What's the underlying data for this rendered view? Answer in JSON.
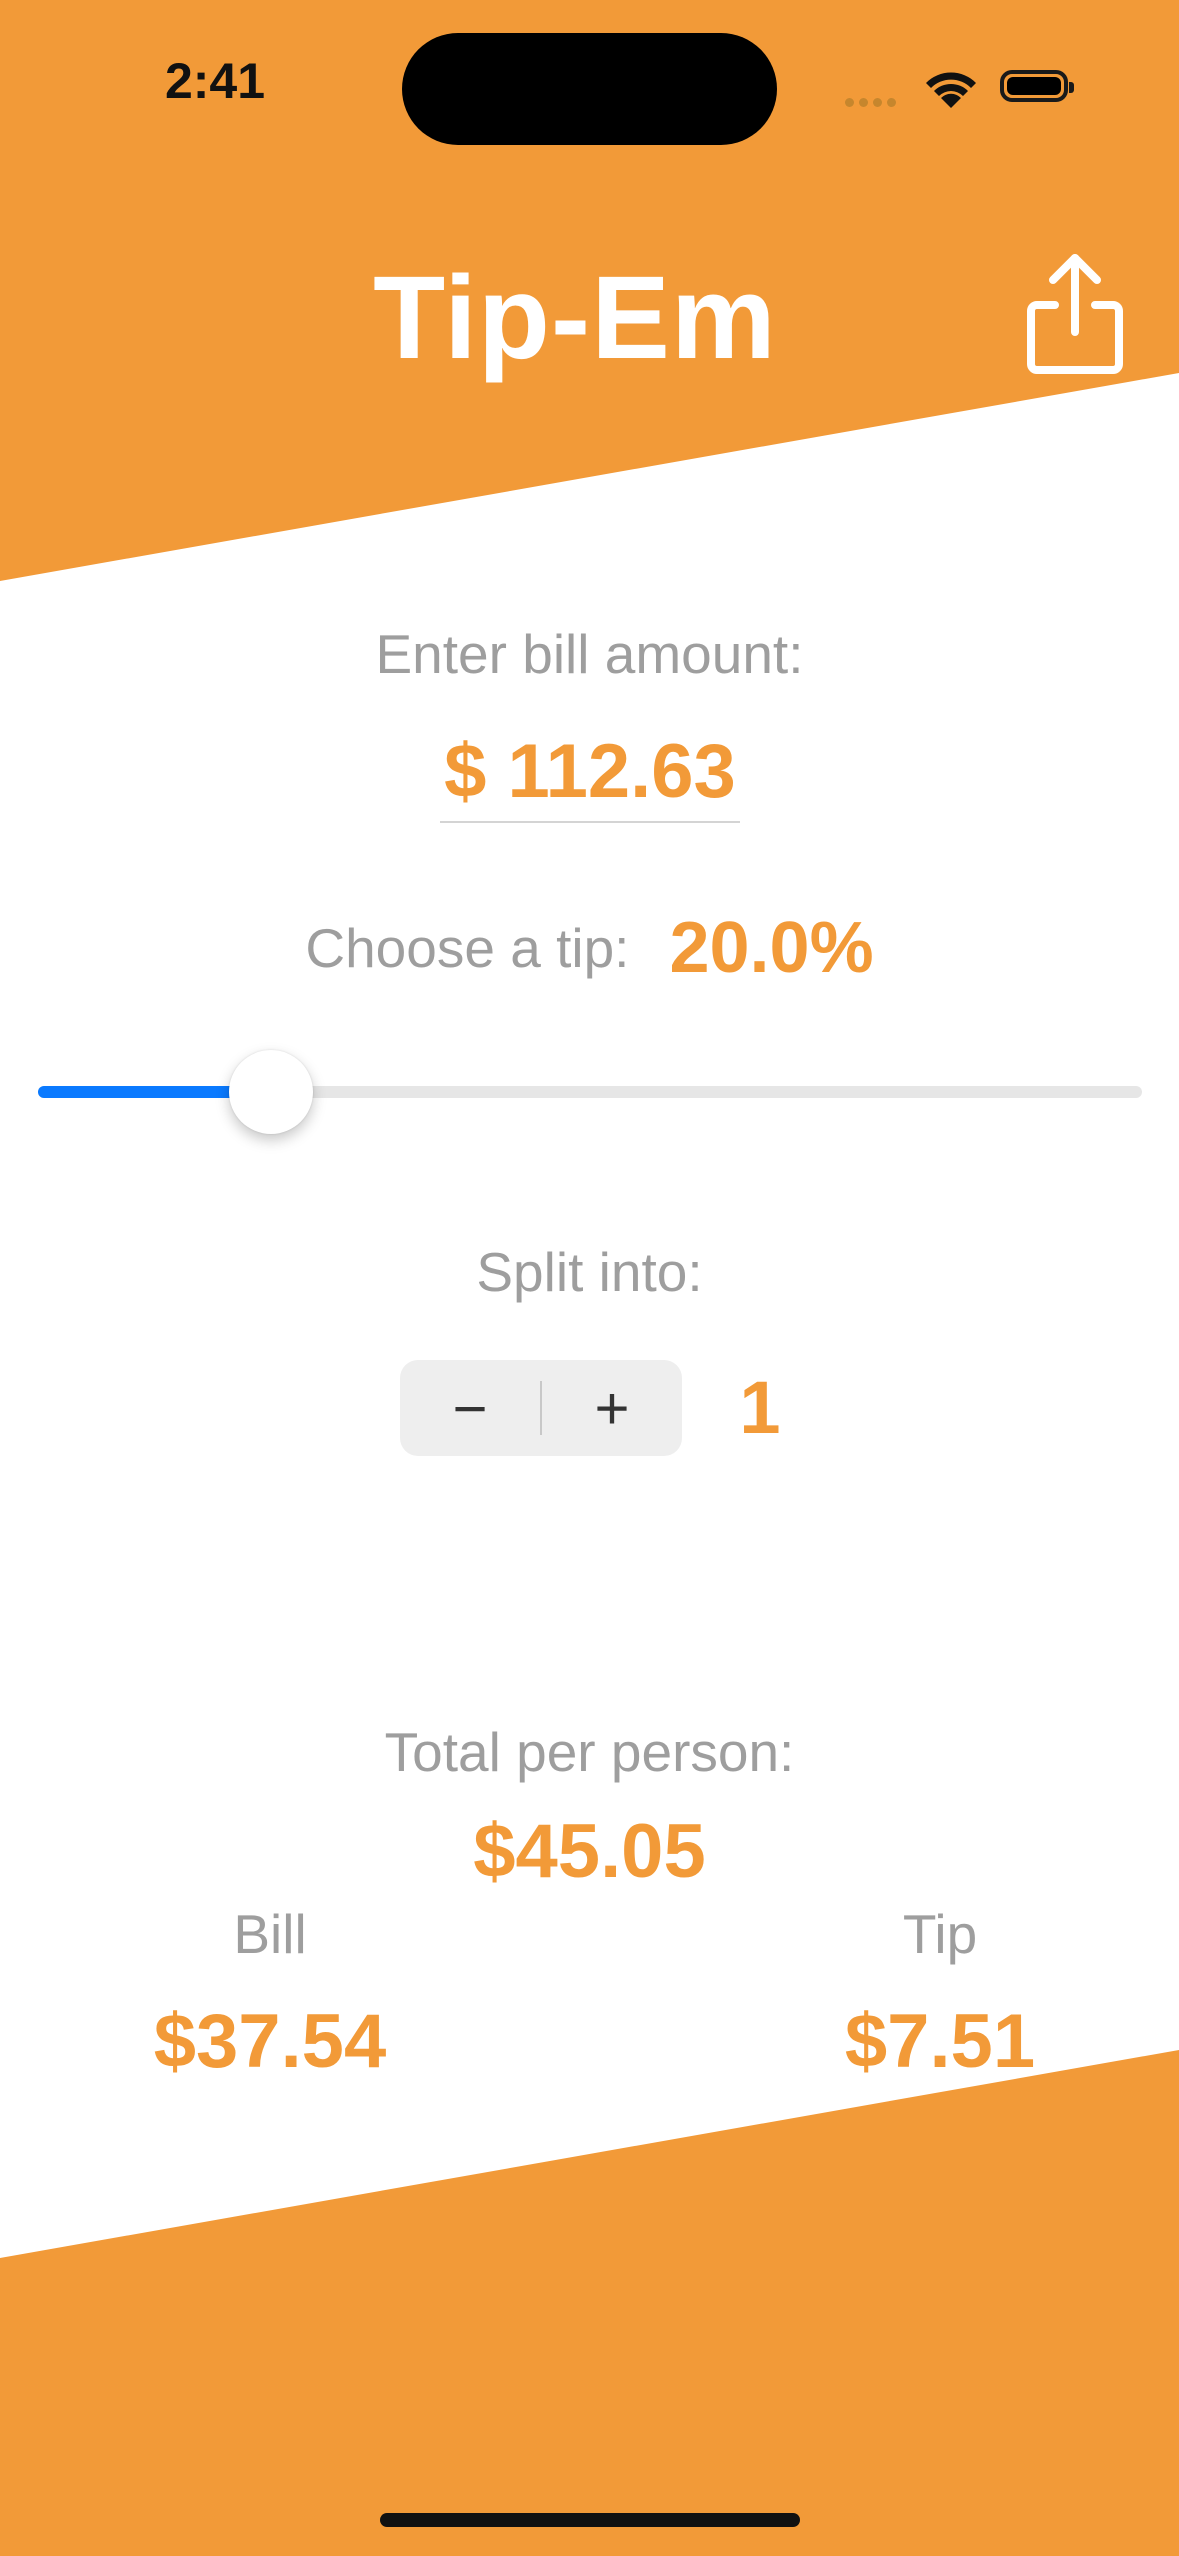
{
  "status_bar": {
    "time": "2:41"
  },
  "header": {
    "title": "Tip-Em",
    "share_icon": "share-icon"
  },
  "bill": {
    "label": "Enter bill amount:",
    "value": "$ 112.63"
  },
  "tip": {
    "label": "Choose a tip:",
    "value": "20.0%",
    "slider_fraction": 0.2
  },
  "split": {
    "label": "Split into:",
    "minus": "−",
    "plus": "+",
    "count": "1"
  },
  "results": {
    "total_label": "Total per person:",
    "total_value": "$45.05",
    "bill_label": "Bill",
    "bill_value": "$37.54",
    "tip_label": "Tip",
    "tip_value": "$7.51"
  },
  "colors": {
    "accent": "#f29a38",
    "slider_fill": "#0a7aff",
    "label_gray": "#9e9e9e"
  }
}
